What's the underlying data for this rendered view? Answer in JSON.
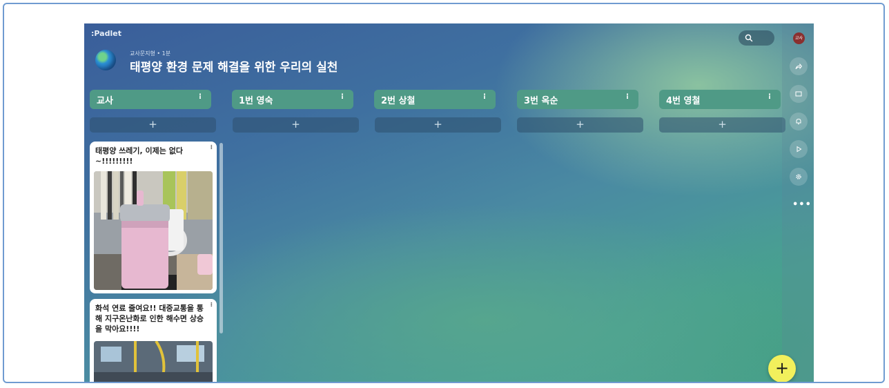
{
  "app": {
    "brand": ":Padlet"
  },
  "board": {
    "subtitle": "교사문지형 • 1분",
    "title": "태평양 환경 문제 해결을 위한 우리의 실천",
    "icon": "globe-icon"
  },
  "toolbar": {
    "search_icon": "search-icon"
  },
  "sidebar": {
    "avatar_text": "교사",
    "buttons": [
      "share-icon",
      "slideshow-icon",
      "bell-icon",
      "play-icon",
      "gear-icon"
    ],
    "more_label": "•••"
  },
  "sections": [
    {
      "label": "교사",
      "menu": "⁝",
      "add_label": "+"
    },
    {
      "label": "1번 영숙",
      "menu": "⁝",
      "add_label": "+"
    },
    {
      "label": "2번 상철",
      "menu": "⁝",
      "add_label": "+"
    },
    {
      "label": "3번 옥순",
      "menu": "⁝",
      "add_label": "+"
    },
    {
      "label": "4번 영철",
      "menu": "⁝",
      "add_label": "+"
    }
  ],
  "posts": [
    {
      "text": "태평양 쓰레기, 이제는 없다~!!!!!!!!!",
      "menu": "⁝"
    },
    {
      "text": "화석 연료 줄여요!! 대중교통을 통해 지구온난화로 인한 해수면 상승을 막아요!!!!",
      "menu": "⁝"
    }
  ],
  "fab": {
    "label": "+"
  },
  "colors": {
    "section_header": "#4f9a86",
    "fab": "#f2f05c",
    "frame_border": "#6f9bd1"
  }
}
